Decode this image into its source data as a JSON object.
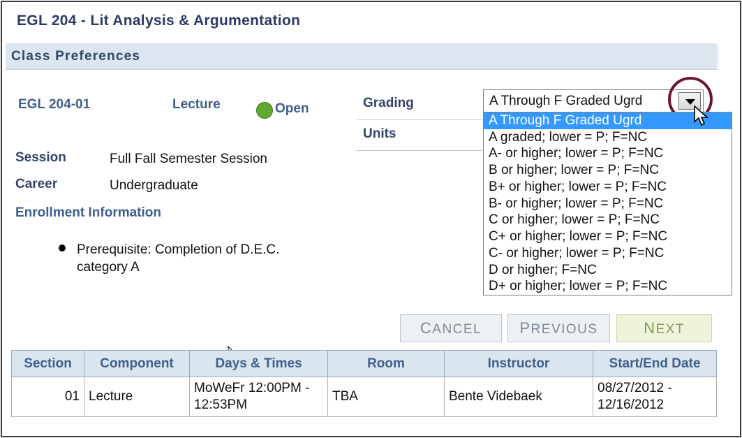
{
  "course_title": "EGL  204 - Lit Analysis & Argumentation",
  "section_header": "Class Preferences",
  "class_info": {
    "section_code": "EGL  204-01",
    "component": "Lecture",
    "status": "Open",
    "status_color": "#5fa832"
  },
  "details": {
    "session_label": "Session",
    "session_value": "Full Fall Semester Session",
    "career_label": "Career",
    "career_value": "Undergraduate",
    "enrollment_heading": "Enrollment Information",
    "enrollment_line1": "Prerequisite: Completion of D.E.C.",
    "enrollment_line2": "category A"
  },
  "grading": {
    "label": "Grading",
    "selected_value": "A Through F Graded Ugrd",
    "options": [
      "A Through F Graded Ugrd",
      "A graded; lower = P; F=NC",
      "A- or higher; lower = P; F=NC",
      "B or higher; lower = P; F=NC",
      "B+ or higher; lower = P; F=NC",
      "B- or higher; lower = P; F=NC",
      "C or higher; lower = P; F=NC",
      "C+ or higher; lower = P; F=NC",
      "C- or higher; lower = P; F=NC",
      "D or higher; F=NC",
      "D+ or higher; lower = P; F=NC"
    ],
    "dropdown_icon": "chevron-down-icon"
  },
  "units": {
    "label": "Units"
  },
  "buttons": {
    "cancel": {
      "first": "C",
      "rest": "ANCEL"
    },
    "previous": {
      "first": "P",
      "rest": "REVIOUS"
    },
    "next": {
      "first": "N",
      "rest": "EXT"
    }
  },
  "table": {
    "headers": [
      "Section",
      "Component",
      "Days & Times",
      "Room",
      "Instructor",
      "Start/End Date"
    ],
    "rows": [
      {
        "section": "01",
        "component": "Lecture",
        "days_times_1": "MoWeFr 12:00PM -",
        "days_times_2": "12:53PM",
        "room": "TBA",
        "instructor": "Bente Videbaek",
        "dates_1": "08/27/2012 -",
        "dates_2": "12/16/2012"
      }
    ]
  },
  "colors": {
    "heading_blue": "#3e5f8c",
    "band_bg": "#dde6ef",
    "selected_option": "#3399ff",
    "highlight_circle": "#6b1730",
    "next_button_bg": "#eef4dc"
  }
}
